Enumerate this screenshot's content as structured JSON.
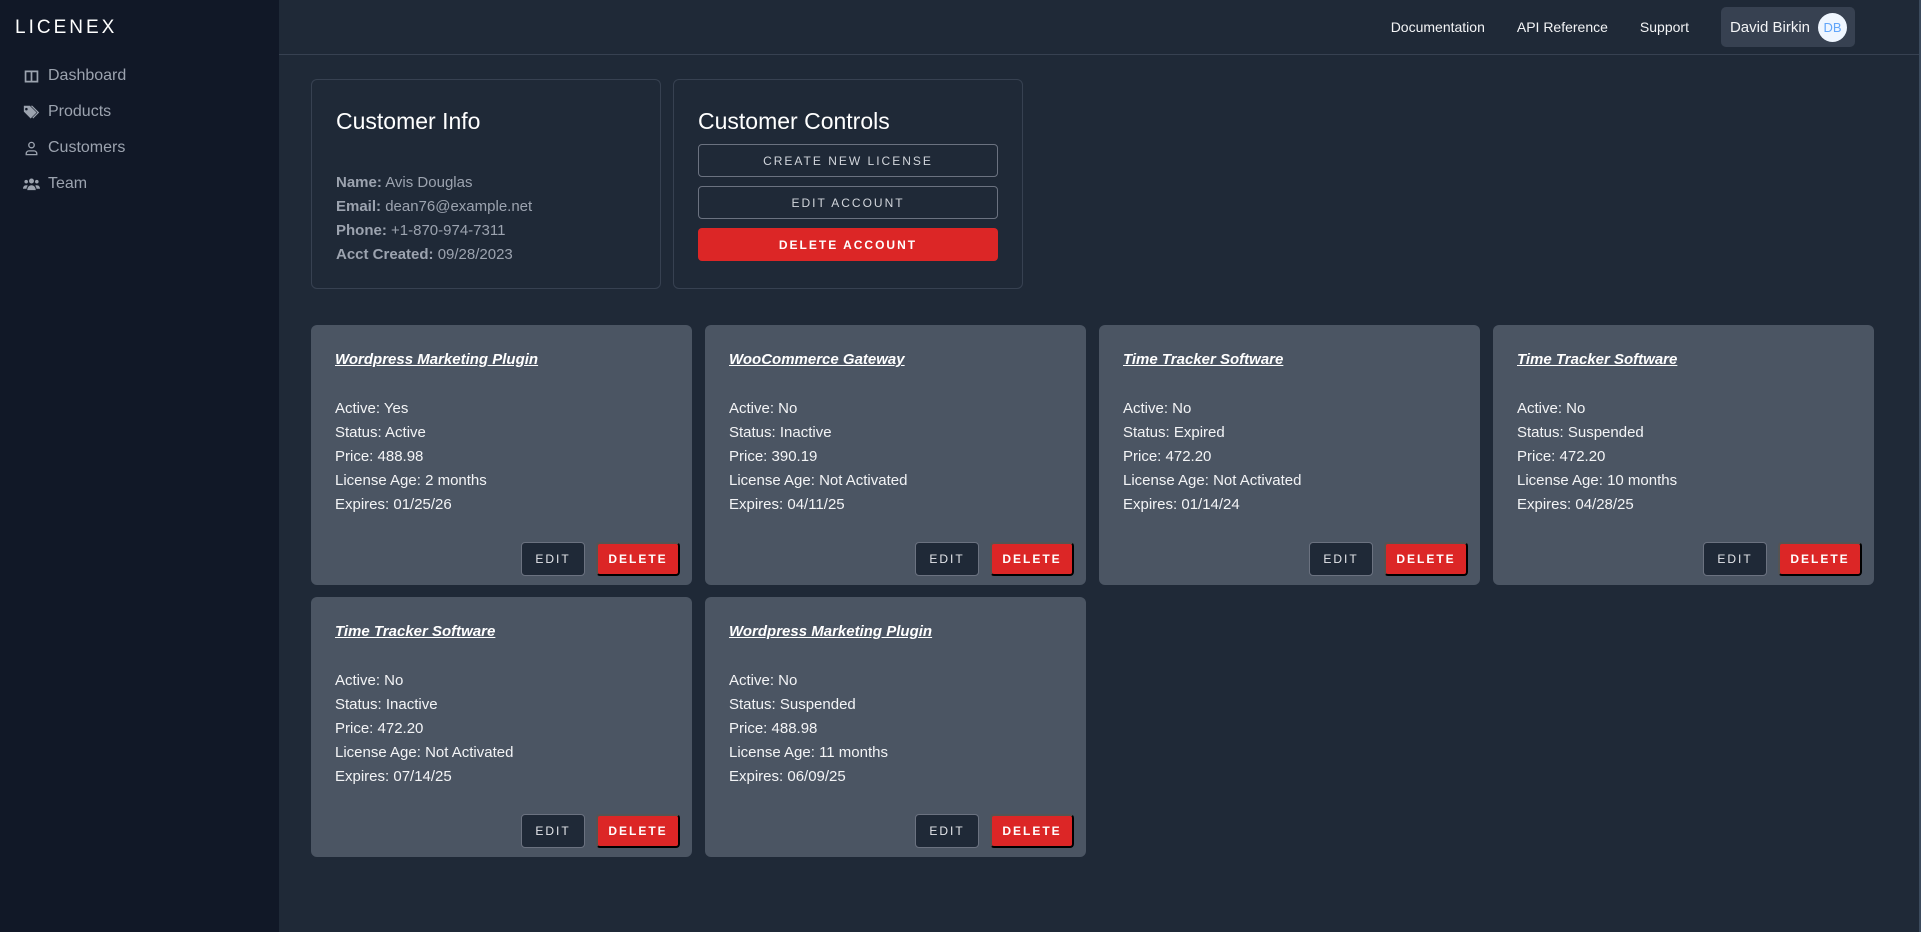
{
  "brand": "LICENEX",
  "sidebar": {
    "items": [
      {
        "label": "Dashboard",
        "icon": "dashboard-icon"
      },
      {
        "label": "Products",
        "icon": "tags-icon"
      },
      {
        "label": "Customers",
        "icon": "user-icon"
      },
      {
        "label": "Team",
        "icon": "users-icon"
      }
    ]
  },
  "header": {
    "links": [
      "Documentation",
      "API Reference",
      "Support"
    ],
    "user": {
      "name": "David Birkin",
      "initials": "DB"
    }
  },
  "customer_info": {
    "title": "Customer Info",
    "fields": [
      {
        "label": "Name:",
        "value": "Avis Douglas"
      },
      {
        "label": "Email:",
        "value": "dean76@example.net"
      },
      {
        "label": "Phone:",
        "value": "+1-870-974-7311"
      },
      {
        "label": "Acct Created:",
        "value": "09/28/2023"
      }
    ]
  },
  "customer_controls": {
    "title": "Customer Controls",
    "create_label": "CREATE NEW LICENSE",
    "edit_label": "EDIT ACCOUNT",
    "delete_label": "DELETE ACCOUNT"
  },
  "licenses": {
    "edit_label": "EDIT",
    "delete_label": "DELETE",
    "items": [
      {
        "product": "Wordpress Marketing Plugin",
        "active": "Active: Yes",
        "status": "Status: Active",
        "price": "Price: 488.98",
        "age": "License Age: 2 months",
        "expires": "Expires: 01/25/26"
      },
      {
        "product": "WooCommerce Gateway",
        "active": "Active: No",
        "status": "Status: Inactive",
        "price": "Price: 390.19",
        "age": "License Age: Not Activated",
        "expires": "Expires: 04/11/25"
      },
      {
        "product": "Time Tracker Software",
        "active": "Active: No",
        "status": "Status: Expired",
        "price": "Price: 472.20",
        "age": "License Age: Not Activated",
        "expires": "Expires: 01/14/24"
      },
      {
        "product": "Time Tracker Software",
        "active": "Active: No",
        "status": "Status: Suspended",
        "price": "Price: 472.20",
        "age": "License Age: 10 months",
        "expires": "Expires: 04/28/25"
      },
      {
        "product": "Time Tracker Software",
        "active": "Active: No",
        "status": "Status: Inactive",
        "price": "Price: 472.20",
        "age": "License Age: Not Activated",
        "expires": "Expires: 07/14/25"
      },
      {
        "product": "Wordpress Marketing Plugin",
        "active": "Active: No",
        "status": "Status: Suspended",
        "price": "Price: 488.98",
        "age": "License Age: 11 months",
        "expires": "Expires: 06/09/25"
      }
    ]
  },
  "colors": {
    "sidebar_bg": "#111827",
    "main_bg": "#1f2937",
    "card_bg": "#4b5563",
    "danger": "#dc2626",
    "avatar_text": "#60a5fa"
  }
}
